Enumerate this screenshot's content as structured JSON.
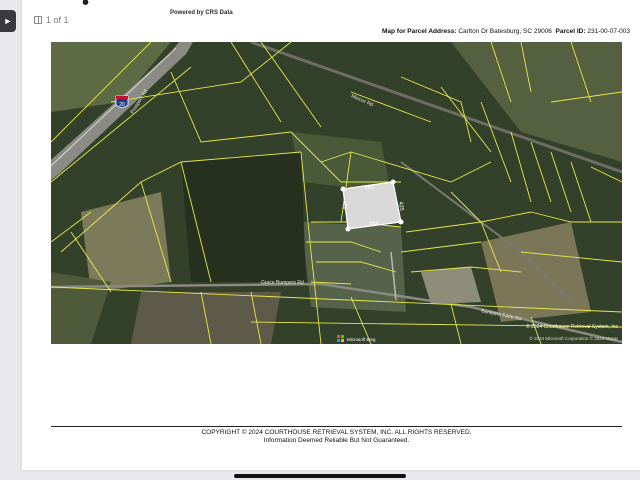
{
  "viewer": {
    "page_indicator": "1 of 1"
  },
  "document": {
    "brand_text": "• ",
    "powered_by": "Powered by CRS Data",
    "map_title_label": "Map for Parcel Address:",
    "map_title_address": "Carlton Dr Batesburg, SC 29006",
    "parcel_label": "Parcel ID:",
    "parcel_id": "231-00-07-003",
    "map": {
      "labels": {
        "interstate": "20",
        "road_nw": "Prospect Rd",
        "road_ne": "Mercer Rd",
        "road_main": "Grace Bumpers Rd",
        "road_se": "Bumpers Farm Rd",
        "dim_top": "580",
        "dim_bottom": "556",
        "dim_left": "427",
        "dim_right": "425"
      },
      "attribution_top": "© 2024 Courthouse Retrieval System, Inc",
      "attribution_bottom": "© 2024 Microsoft Corporation © 2024 Maxar",
      "bing_label": "Microsoft Bing"
    },
    "footer": {
      "copyright": "COPYRIGHT © 2024 COURTHOUSE RETRIEVAL SYSTEM, INC. ALL RIGHTS RESERVED.",
      "disclaimer": "Information Deemed Reliable But Not Guaranteed."
    }
  },
  "colors": {
    "parcel_lines": "#e6e84a",
    "subject_parcel_fill": "#d9d9d9",
    "forest": "#2f3a26",
    "field": "#8a8a60"
  }
}
